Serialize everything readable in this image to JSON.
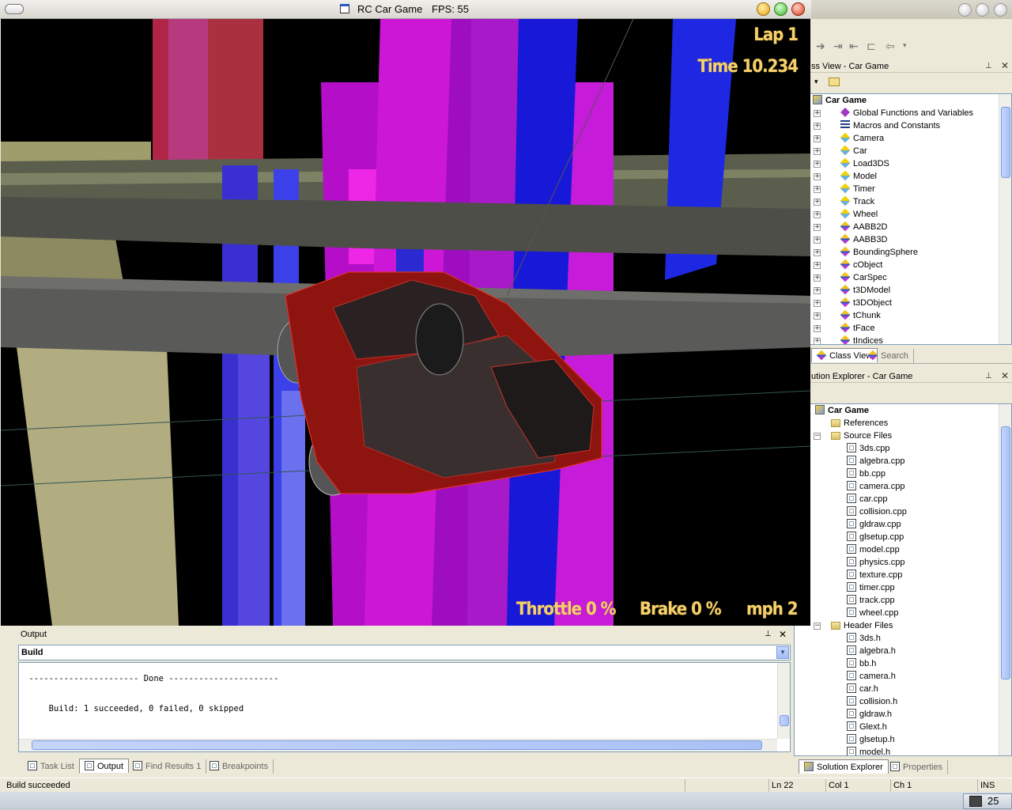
{
  "game": {
    "title": "RC Car Game",
    "fps": "FPS: 55",
    "hud": {
      "lap": "Lap 1",
      "time": "Time 10.234",
      "throttle": "Throttle  0 %",
      "brake": "Brake  0 %",
      "mph": "mph  2"
    }
  },
  "class_view": {
    "title": "ss View - Car Game",
    "root": "Car Game",
    "items": [
      {
        "label": "Global Functions and Variables",
        "icon": "gfv"
      },
      {
        "label": "Macros and Constants",
        "icon": "macro"
      },
      {
        "label": "Camera",
        "icon": "struct"
      },
      {
        "label": "Car",
        "icon": "struct"
      },
      {
        "label": "Load3DS",
        "icon": "struct"
      },
      {
        "label": "Model",
        "icon": "struct"
      },
      {
        "label": "Timer",
        "icon": "struct"
      },
      {
        "label": "Track",
        "icon": "struct"
      },
      {
        "label": "Wheel",
        "icon": "struct"
      },
      {
        "label": "AABB2D",
        "icon": "class"
      },
      {
        "label": "AABB3D",
        "icon": "class"
      },
      {
        "label": "BoundingSphere",
        "icon": "class"
      },
      {
        "label": "cObject",
        "icon": "class"
      },
      {
        "label": "CarSpec",
        "icon": "class"
      },
      {
        "label": "t3DModel",
        "icon": "class"
      },
      {
        "label": "t3DObject",
        "icon": "class"
      },
      {
        "label": "tChunk",
        "icon": "class"
      },
      {
        "label": "tFace",
        "icon": "class"
      },
      {
        "label": "tIndices",
        "icon": "class"
      }
    ],
    "tabs": {
      "class_view": "Class View",
      "search": "Search"
    }
  },
  "solution_explorer": {
    "title": "ution Explorer - Car Game",
    "root": "Car Game",
    "references": "References",
    "source_folder": "Source Files",
    "source_files": [
      "3ds.cpp",
      "algebra.cpp",
      "bb.cpp",
      "camera.cpp",
      "car.cpp",
      "collision.cpp",
      "gldraw.cpp",
      "glsetup.cpp",
      "model.cpp",
      "physics.cpp",
      "texture.cpp",
      "timer.cpp",
      "track.cpp",
      "wheel.cpp"
    ],
    "header_folder": "Header Files",
    "header_files": [
      "3ds.h",
      "algebra.h",
      "bb.h",
      "camera.h",
      "car.h",
      "collision.h",
      "gldraw.h",
      "Glext.h",
      "glsetup.h",
      "model.h"
    ],
    "tabs": {
      "solution_explorer": "Solution Explorer",
      "properties": "Properties"
    }
  },
  "output": {
    "title": "Output",
    "dropdown": "Build",
    "line1": " ---------------------- Done ----------------------",
    "line2": "     Build: 1 succeeded, 0 failed, 0 skipped"
  },
  "bottom_tabs": {
    "task_list": "Task List",
    "output": "Output",
    "find_results": "Find Results 1",
    "breakpoints": "Breakpoints"
  },
  "status": {
    "message": "Build succeeded",
    "ln": "Ln 22",
    "col": "Col 1",
    "ch": "Ch 1",
    "mode": "INS"
  },
  "taskbar": {
    "clock": "25"
  }
}
